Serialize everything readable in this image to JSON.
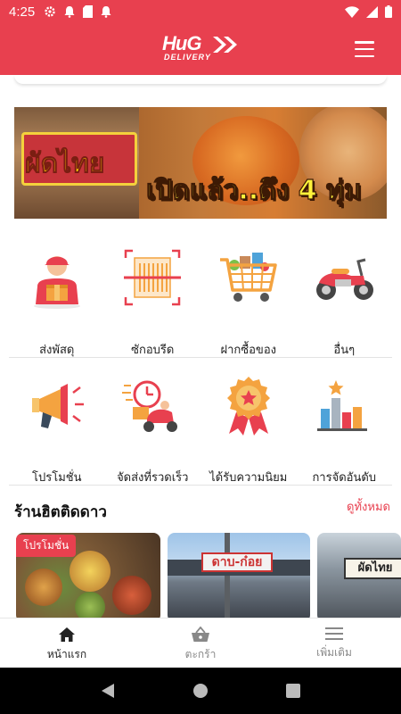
{
  "status_bar": {
    "time": "4:25"
  },
  "app_bar": {
    "logo_text": "HuG",
    "logo_subtext": "DELIVERY"
  },
  "banner": {
    "sign_text": "ผัดไทย",
    "promo_text": "เปิดแล้ว..ดึง 4 ทุ่ม"
  },
  "services": [
    {
      "label": "ส่งพัสดุ",
      "icon": "delivery-man-icon"
    },
    {
      "label": "ซักอบรีด",
      "icon": "laundry-icon"
    },
    {
      "label": "ฝากซื้อของ",
      "icon": "shopping-cart-icon"
    },
    {
      "label": "อื่นๆ",
      "icon": "scooter-icon"
    }
  ],
  "features": [
    {
      "label": "โปรโมชั่น",
      "icon": "megaphone-icon"
    },
    {
      "label": "จัดส่งที่รวดเร็ว",
      "icon": "fast-delivery-icon"
    },
    {
      "label": "ได้รับความนิยม",
      "icon": "badge-star-icon"
    },
    {
      "label": "การจัดอันดับ",
      "icon": "ranking-chart-icon"
    }
  ],
  "section": {
    "title": "ร้านฮิตติดดาว",
    "see_all": "ดูทั้งหมด"
  },
  "shops": [
    {
      "badge": "โปรโมชั่น"
    },
    {
      "sign": "ดาบ-ก๋อย"
    },
    {
      "sign": "ผัดไทย"
    }
  ],
  "bottom_nav": [
    {
      "label": "หน้าแรก",
      "icon": "home-icon",
      "active": true
    },
    {
      "label": "ตะกร้า",
      "icon": "basket-icon",
      "active": false
    },
    {
      "label": "เพิ่มเติม",
      "icon": "menu-icon",
      "active": false
    }
  ],
  "colors": {
    "brand": "#e8404f",
    "accent": "#e8404f"
  }
}
